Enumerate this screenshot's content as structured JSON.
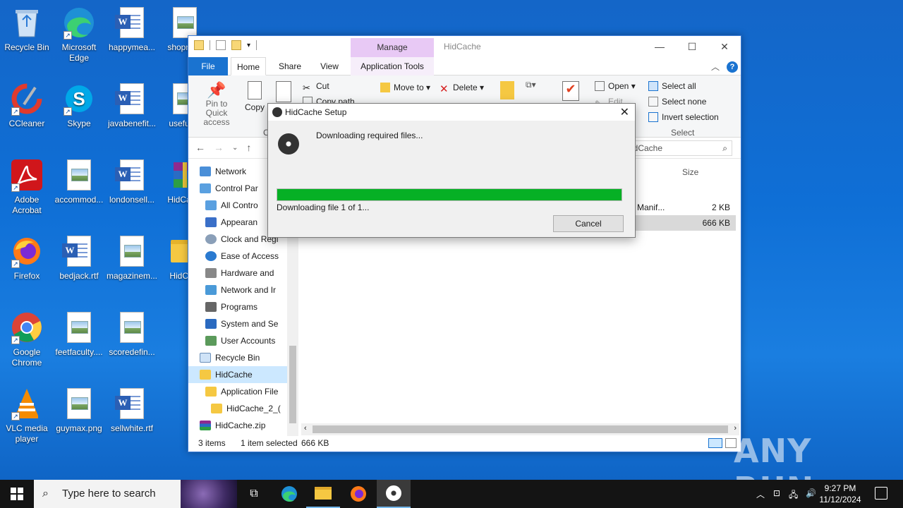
{
  "desktop": {
    "icons": [
      {
        "label": "Recycle Bin",
        "icon": "recycle-bin-icon"
      },
      {
        "label": "Microsoft Edge",
        "icon": "edge-icon"
      },
      {
        "label": "happymea...",
        "icon": "word-doc-icon"
      },
      {
        "label": "shopne...",
        "icon": "image-file-icon"
      },
      {
        "label": "CCleaner",
        "icon": "ccleaner-icon"
      },
      {
        "label": "Skype",
        "icon": "skype-icon"
      },
      {
        "label": "javabenefit...",
        "icon": "word-doc-icon"
      },
      {
        "label": "usefulr...",
        "icon": "image-file-icon"
      },
      {
        "label": "Adobe Acrobat",
        "icon": "acrobat-icon"
      },
      {
        "label": "accommod...",
        "icon": "image-file-icon"
      },
      {
        "label": "londonsell...",
        "icon": "word-doc-icon"
      },
      {
        "label": "HidCac...",
        "icon": "winrar-icon"
      },
      {
        "label": "Firefox",
        "icon": "firefox-icon"
      },
      {
        "label": "bedjack.rtf",
        "icon": "word-doc-icon"
      },
      {
        "label": "magazinem...",
        "icon": "image-file-icon"
      },
      {
        "label": "HidCa...",
        "icon": "folder-icon"
      },
      {
        "label": "Google Chrome",
        "icon": "chrome-icon"
      },
      {
        "label": "feetfaculty....",
        "icon": "image-file-icon"
      },
      {
        "label": "scoredefin...",
        "icon": "image-file-icon"
      },
      {
        "label": "VLC media player",
        "icon": "vlc-icon"
      },
      {
        "label": "guymax.png",
        "icon": "image-file-icon"
      },
      {
        "label": "sellwhite.rtf",
        "icon": "word-doc-icon"
      }
    ]
  },
  "explorer": {
    "manage_tab": "Manage",
    "title": "HidCache",
    "tabs": {
      "file": "File",
      "home": "Home",
      "share": "Share",
      "view": "View",
      "app_tools": "Application Tools"
    },
    "ribbon": {
      "pin": "Pin to Quick access",
      "copy": "Copy",
      "cut": "Cut",
      "copy_path": "Copy path",
      "move_to": "Move to",
      "delete": "Delete",
      "open": "Open",
      "edit": "Edit",
      "select_all": "Select all",
      "select_none": "Select none",
      "invert_selection": "Invert selection",
      "select_group": "Select",
      "clipboard_group": "C"
    },
    "search_value": "idCache",
    "tree": [
      {
        "label": "Network",
        "level": 0
      },
      {
        "label": "Control Par",
        "level": 0
      },
      {
        "label": "All Contro",
        "level": 1
      },
      {
        "label": "Appearan",
        "level": 1
      },
      {
        "label": "Clock and Regi",
        "level": 1
      },
      {
        "label": "Ease of Access",
        "level": 1
      },
      {
        "label": "Hardware and",
        "level": 1
      },
      {
        "label": "Network and Ir",
        "level": 1
      },
      {
        "label": "Programs",
        "level": 1
      },
      {
        "label": "System and Se",
        "level": 1
      },
      {
        "label": "User Accounts",
        "level": 1
      },
      {
        "label": "Recycle Bin",
        "level": 0
      },
      {
        "label": "HidCache",
        "level": 0
      },
      {
        "label": "Application File",
        "level": 1
      },
      {
        "label": "HidCache_2_(",
        "level": 2
      },
      {
        "label": "HidCache.zip",
        "level": 0
      }
    ],
    "columns": {
      "size": "Size"
    },
    "files": [
      {
        "name": "n Manif...",
        "size": "2 KB"
      },
      {
        "name": "n",
        "size": "666 KB"
      }
    ],
    "status": {
      "items": "3 items",
      "selected": "1 item selected",
      "size": "666 KB"
    }
  },
  "dialog": {
    "title": "HidCache Setup",
    "message": "Downloading required files...",
    "progress": 1.0,
    "status": "Downloading file 1 of 1...",
    "cancel": "Cancel",
    "progress_color": "#06b025"
  },
  "watermark": "ANY RUN",
  "taskbar": {
    "search_placeholder": "Type here to search",
    "time": "9:27 PM",
    "date": "11/12/2024"
  }
}
